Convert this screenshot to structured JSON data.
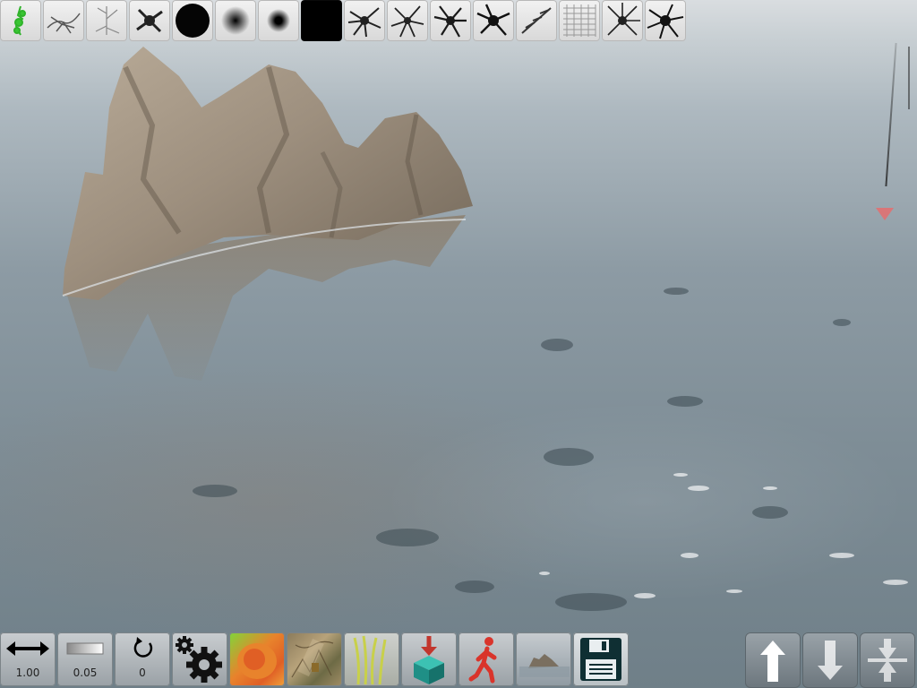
{
  "brush_bar": {
    "brushes": [
      {
        "icon": "green-scatter-brush-icon",
        "active": false
      },
      {
        "icon": "dark-scatter-brush-icon",
        "active": false
      },
      {
        "icon": "light-branch-brush-icon",
        "active": false
      },
      {
        "icon": "splat-brush-icon",
        "active": false
      },
      {
        "icon": "hard-round-brush-icon",
        "active": false
      },
      {
        "icon": "soft-round-brush-icon",
        "active": false
      },
      {
        "icon": "small-round-brush-icon",
        "active": false
      },
      {
        "icon": "solid-square-brush-icon",
        "active": true
      },
      {
        "icon": "burst-brush-icon",
        "active": false
      },
      {
        "icon": "burst-brush-2-icon",
        "active": false
      },
      {
        "icon": "burst-brush-3-icon",
        "active": false
      },
      {
        "icon": "burst-brush-4-icon",
        "active": false
      },
      {
        "icon": "streak-brush-icon",
        "active": false
      },
      {
        "icon": "texture-brush-icon",
        "active": false
      },
      {
        "icon": "burst-brush-5-icon",
        "active": false
      },
      {
        "icon": "burst-brush-6-icon",
        "active": false
      }
    ]
  },
  "toolbar": {
    "size_value": "1.00",
    "opacity_value": "0.05",
    "rotation_value": "0",
    "tools": [
      "size-slider-icon",
      "opacity-slider-icon",
      "rotation-icon",
      "settings-gear-icon",
      "heightmap-paint-icon",
      "ground-texture-icon",
      "grass-icon",
      "place-object-icon",
      "walk-mode-icon",
      "terrain-preview-icon",
      "save-icon"
    ],
    "nav": [
      "raise-arrow-icon",
      "lower-arrow-icon",
      "flatten-icon"
    ]
  },
  "colors": {
    "accent_red": "#d9342b",
    "heightmap_orange": "#e8832c",
    "object_teal": "#1f8f86",
    "grass_yellow": "#c8d04a"
  }
}
